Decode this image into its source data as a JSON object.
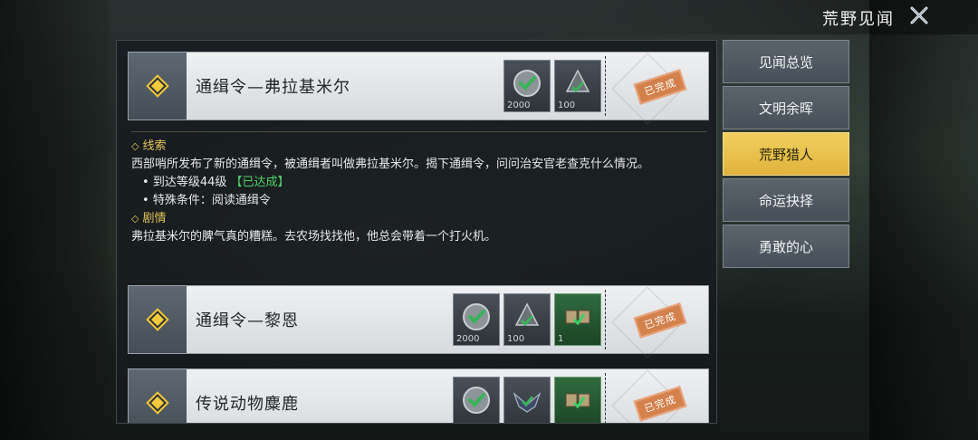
{
  "header": {
    "title": "荒野见闻",
    "close_icon": "close-x-icon"
  },
  "tabs": [
    {
      "label": "见闻总览",
      "active": false
    },
    {
      "label": "文明余晖",
      "active": false
    },
    {
      "label": "荒野猎人",
      "active": true
    },
    {
      "label": "命运抉择",
      "active": false
    },
    {
      "label": "勇敢的心",
      "active": false
    }
  ],
  "quests": [
    {
      "title": "通缉令—弗拉基米尔",
      "status": "已完成",
      "rewards": [
        {
          "icon": "check-coin-icon",
          "qty": "2000",
          "style": "gray"
        },
        {
          "icon": "emblem-icon",
          "qty": "100",
          "style": "gray"
        }
      ]
    },
    {
      "title": "通缉令—黎恩",
      "status": "已完成",
      "rewards": [
        {
          "icon": "check-coin-icon",
          "qty": "2000",
          "style": "gray"
        },
        {
          "icon": "emblem-icon",
          "qty": "100",
          "style": "gray"
        },
        {
          "icon": "ticket-icon",
          "qty": "1",
          "style": "green"
        }
      ]
    },
    {
      "title": "传说动物麋鹿",
      "status": "已完成",
      "rewards": [
        {
          "icon": "check-coin-icon",
          "qty": "",
          "style": "gray"
        },
        {
          "icon": "wing-badge-icon",
          "qty": "",
          "style": "gray"
        },
        {
          "icon": "ticket-icon",
          "qty": "",
          "style": "green"
        }
      ]
    }
  ],
  "detail": {
    "clue_heading": "线索",
    "clue_text": "西部哨所发布了新的通缉令，被通缉者叫做弗拉基米尔。揭下通缉令，问问治安官老查克什么情况。",
    "req1_text": "到达等级44级",
    "req1_status": "【已达成】",
    "req2_text": "特殊条件：阅读通缉令",
    "story_heading": "剧情",
    "story_text": "弗拉基米尔的脾气真的糟糕。去农场找找他，他总会带着一个打火机。"
  }
}
